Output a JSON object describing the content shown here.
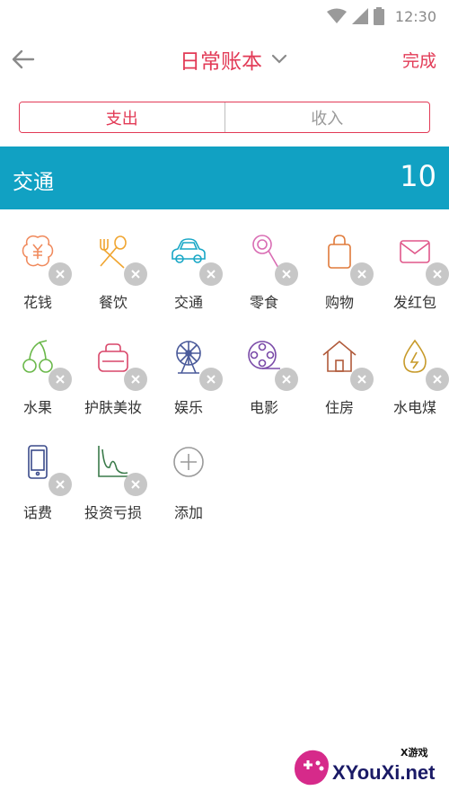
{
  "status_bar": {
    "time": "12:30",
    "icons": [
      "wifi-icon",
      "signal-icon",
      "battery-icon"
    ]
  },
  "header": {
    "title": "日常账本",
    "done_label": "完成",
    "back_icon": "arrow-left-icon",
    "dropdown_icon": "chevron-down-icon"
  },
  "segments": {
    "expense": "支出",
    "income": "收入",
    "active": "expense"
  },
  "banner": {
    "category": "交通",
    "amount": "10"
  },
  "colors": {
    "accent": "#e23a56",
    "banner": "#11a1c3"
  },
  "categories": [
    {
      "label": "花钱",
      "icon": "money-bag-icon",
      "color": "#f08a5d"
    },
    {
      "label": "餐饮",
      "icon": "fork-spoon-icon",
      "color": "#f0a530"
    },
    {
      "label": "交通",
      "icon": "car-icon",
      "color": "#19a7c6"
    },
    {
      "label": "零食",
      "icon": "lollipop-icon",
      "color": "#d96cb3"
    },
    {
      "label": "购物",
      "icon": "shopping-bag-icon",
      "color": "#e07a3a"
    },
    {
      "label": "发红包",
      "icon": "envelope-icon",
      "color": "#e0578a"
    },
    {
      "label": "水果",
      "icon": "cherry-icon",
      "color": "#6ab84a"
    },
    {
      "label": "护肤美妆",
      "icon": "cosmetic-bag-icon",
      "color": "#d9476a"
    },
    {
      "label": "娱乐",
      "icon": "ferris-wheel-icon",
      "color": "#4a5a9a"
    },
    {
      "label": "电影",
      "icon": "film-reel-icon",
      "color": "#7a4aa8"
    },
    {
      "label": "住房",
      "icon": "house-icon",
      "color": "#b05a3a"
    },
    {
      "label": "水电煤",
      "icon": "utility-drop-icon",
      "color": "#c79a2a"
    },
    {
      "label": "话费",
      "icon": "phone-icon",
      "color": "#3a4a8a"
    },
    {
      "label": "投资亏损",
      "icon": "chart-loss-icon",
      "color": "#3a7a4a"
    },
    {
      "label": "添加",
      "icon": "plus-circle-icon",
      "color": "#9a9a9a"
    }
  ],
  "watermark": {
    "brand": "XYouXi.net",
    "small": "X游戏"
  }
}
